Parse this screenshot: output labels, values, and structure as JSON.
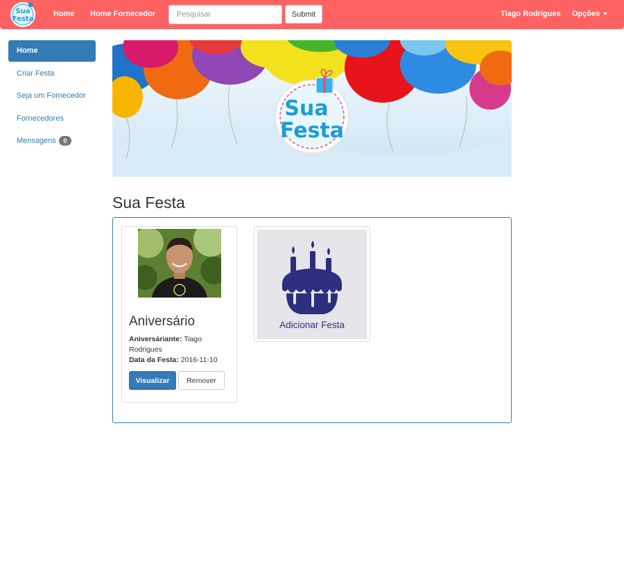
{
  "navbar": {
    "brand_logo_line1": "Sua",
    "brand_logo_line2": "Festa",
    "links": [
      "Home",
      "Home Fornecedor"
    ],
    "search_placeholder": "Pesquisar",
    "submit_label": "Submit",
    "user_name": "Tiago Rodrigues",
    "options_label": "Opções",
    "bg_color": "#ff6262"
  },
  "sidebar": {
    "items": [
      {
        "label": "Home",
        "active": true
      },
      {
        "label": "Criar Festa"
      },
      {
        "label": "Seja um Fornecedor"
      },
      {
        "label": "Fornecedores"
      },
      {
        "label": "Mensagens",
        "badge": "0"
      }
    ],
    "accent": "#337ab7"
  },
  "banner": {
    "logo_line1": "Sua",
    "logo_line2": "Festa"
  },
  "main": {
    "title": "Sua Festa",
    "party_card": {
      "title": "Aniversário",
      "birthday_label": "Aniversáriante:",
      "birthday_value": "Tiago Rodrigues",
      "date_label": "Data da Festa:",
      "date_value": "2016-11-10",
      "view_label": "Visualizar",
      "remove_label": "Remover"
    },
    "add_card": {
      "label": "Adicionar Festa",
      "icon": "birthday-cake-icon"
    }
  }
}
